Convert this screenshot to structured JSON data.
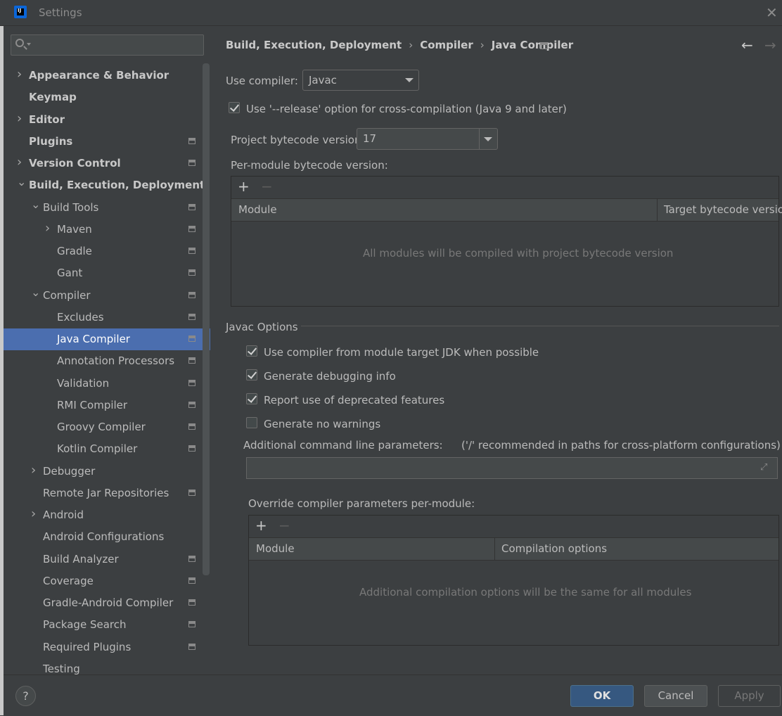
{
  "window": {
    "title": "Settings"
  },
  "search": {
    "placeholder": ""
  },
  "tree": [
    {
      "label": "Appearance & Behavior",
      "bold": true,
      "arrow": "right",
      "indent": 0,
      "icon": false
    },
    {
      "label": "Keymap",
      "bold": true,
      "arrow": "none",
      "indent": 0,
      "icon": false
    },
    {
      "label": "Editor",
      "bold": true,
      "arrow": "right",
      "indent": 0,
      "icon": false
    },
    {
      "label": "Plugins",
      "bold": true,
      "arrow": "none",
      "indent": 0,
      "icon": true
    },
    {
      "label": "Version Control",
      "bold": true,
      "arrow": "right",
      "indent": 0,
      "icon": true
    },
    {
      "label": "Build, Execution, Deployment",
      "bold": true,
      "arrow": "down",
      "indent": 0,
      "icon": false
    },
    {
      "label": "Build Tools",
      "bold": false,
      "arrow": "down",
      "indent": 1,
      "icon": true
    },
    {
      "label": "Maven",
      "bold": false,
      "arrow": "right",
      "indent": 2,
      "icon": true
    },
    {
      "label": "Gradle",
      "bold": false,
      "arrow": "none",
      "indent": 2,
      "icon": true
    },
    {
      "label": "Gant",
      "bold": false,
      "arrow": "none",
      "indent": 2,
      "icon": true
    },
    {
      "label": "Compiler",
      "bold": false,
      "arrow": "down",
      "indent": 1,
      "icon": true
    },
    {
      "label": "Excludes",
      "bold": false,
      "arrow": "none",
      "indent": 2,
      "icon": true
    },
    {
      "label": "Java Compiler",
      "bold": false,
      "arrow": "none",
      "indent": 2,
      "icon": true,
      "selected": true
    },
    {
      "label": "Annotation Processors",
      "bold": false,
      "arrow": "none",
      "indent": 2,
      "icon": true
    },
    {
      "label": "Validation",
      "bold": false,
      "arrow": "none",
      "indent": 2,
      "icon": true
    },
    {
      "label": "RMI Compiler",
      "bold": false,
      "arrow": "none",
      "indent": 2,
      "icon": true
    },
    {
      "label": "Groovy Compiler",
      "bold": false,
      "arrow": "none",
      "indent": 2,
      "icon": true
    },
    {
      "label": "Kotlin Compiler",
      "bold": false,
      "arrow": "none",
      "indent": 2,
      "icon": true
    },
    {
      "label": "Debugger",
      "bold": false,
      "arrow": "right",
      "indent": 1,
      "icon": false
    },
    {
      "label": "Remote Jar Repositories",
      "bold": false,
      "arrow": "none",
      "indent": 1,
      "icon": true
    },
    {
      "label": "Android",
      "bold": false,
      "arrow": "right",
      "indent": 1,
      "icon": false
    },
    {
      "label": "Android Configurations",
      "bold": false,
      "arrow": "none",
      "indent": 1,
      "icon": false
    },
    {
      "label": "Build Analyzer",
      "bold": false,
      "arrow": "none",
      "indent": 1,
      "icon": true
    },
    {
      "label": "Coverage",
      "bold": false,
      "arrow": "none",
      "indent": 1,
      "icon": true
    },
    {
      "label": "Gradle-Android Compiler",
      "bold": false,
      "arrow": "none",
      "indent": 1,
      "icon": true
    },
    {
      "label": "Package Search",
      "bold": false,
      "arrow": "none",
      "indent": 1,
      "icon": true
    },
    {
      "label": "Required Plugins",
      "bold": false,
      "arrow": "none",
      "indent": 1,
      "icon": true
    },
    {
      "label": "Testing",
      "bold": false,
      "arrow": "none",
      "indent": 1,
      "icon": false
    }
  ],
  "breadcrumb": {
    "items": [
      "Build, Execution, Deployment",
      "Compiler",
      "Java Compiler"
    ],
    "separator": "›"
  },
  "compiler": {
    "use_compiler_label": "Use compiler:",
    "use_compiler_value": "Javac",
    "release_option_label": "Use '--release' option for cross-compilation (Java 9 and later)",
    "release_option_checked": true,
    "bytecode_label": "Project bytecode version:",
    "bytecode_value": "17",
    "per_module_label": "Per-module bytecode version:",
    "per_module_table": {
      "col_module": "Module",
      "col_target": "Target bytecode version",
      "empty_text": "All modules will be compiled with project bytecode version"
    }
  },
  "javac": {
    "section_title": "Javac Options",
    "options": [
      {
        "label": "Use compiler from module target JDK when possible",
        "checked": true
      },
      {
        "label": "Generate debugging info",
        "checked": true
      },
      {
        "label": "Report use of deprecated features",
        "checked": true
      },
      {
        "label": "Generate no warnings",
        "checked": false
      }
    ],
    "cmd_label": "Additional command line parameters:",
    "cmd_hint": "('/' recommended in paths for cross-platform configurations)",
    "cmd_value": "",
    "override_label": "Override compiler parameters per-module:",
    "override_table": {
      "col_module": "Module",
      "col_options": "Compilation options",
      "empty_text": "Additional compilation options will be the same for all modules"
    }
  },
  "toolbar": {
    "plus": "+",
    "minus": "−"
  },
  "buttons": {
    "help": "?",
    "ok": "OK",
    "cancel": "Cancel",
    "apply": "Apply"
  },
  "icons": {
    "back": "←",
    "forward": "→",
    "close": "✕",
    "expand": "⤢"
  },
  "colors": {
    "selection": "#4b6eaf",
    "ok_button": "#365880",
    "background": "#3c3f41"
  }
}
